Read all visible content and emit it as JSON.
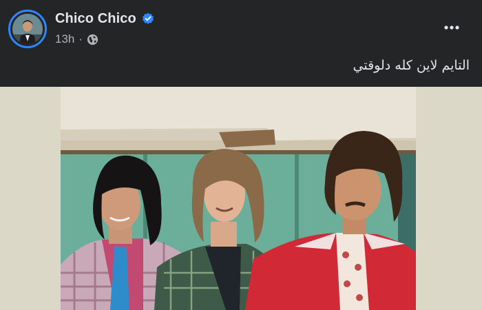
{
  "post": {
    "author": "Chico Chico",
    "verified": true,
    "time": "13h",
    "separator": "·",
    "audience_icon": "globe-icon",
    "text": "التايم لاين كله دلوقتي",
    "more_icon": "more-options-icon"
  },
  "colors": {
    "background": "#242526",
    "text_primary": "#e4e6eb",
    "text_secondary": "#b0b3b8",
    "verified_blue": "#2d88ff"
  },
  "photo": {
    "icon": "photo-image"
  }
}
